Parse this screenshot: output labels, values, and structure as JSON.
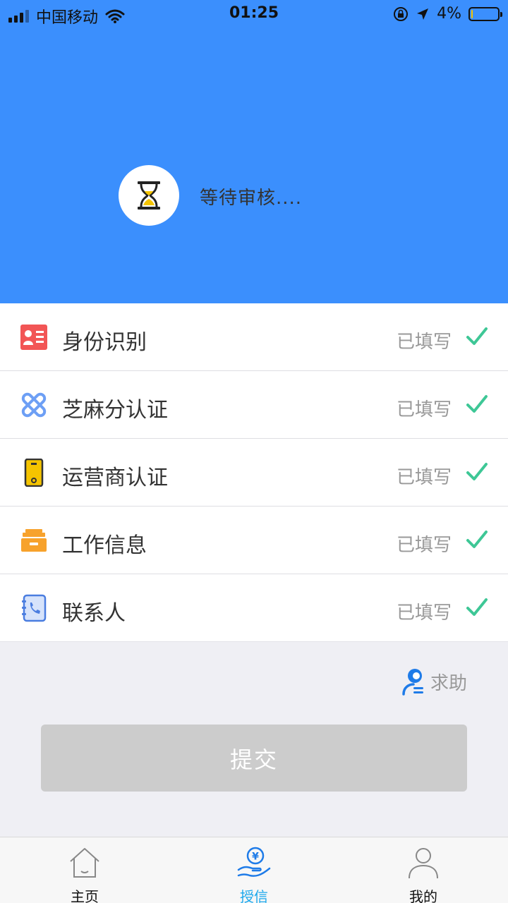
{
  "status_bar": {
    "carrier": "中国移动",
    "time": "01:25",
    "battery": "4%",
    "battery_level": 0.04
  },
  "header": {
    "status_text": "等待审核....",
    "icon": "hourglass-icon",
    "background": "#3b8ffd"
  },
  "items": [
    {
      "label": "身份识别",
      "status": "已填写",
      "icon": "id-card-icon"
    },
    {
      "label": "芝麻分认证",
      "status": "已填写",
      "icon": "sesame-icon"
    },
    {
      "label": "运营商认证",
      "status": "已填写",
      "icon": "phone-icon"
    },
    {
      "label": "工作信息",
      "status": "已填写",
      "icon": "briefcase-icon"
    },
    {
      "label": "联系人",
      "status": "已填写",
      "icon": "contacts-icon"
    }
  ],
  "help": {
    "label": "求助",
    "icon": "help-icon"
  },
  "submit": {
    "label": "提交"
  },
  "tabbar": {
    "items": [
      {
        "label": "主页",
        "icon": "home-icon",
        "active": false
      },
      {
        "label": "授信",
        "icon": "credit-icon",
        "active": true
      },
      {
        "label": "我的",
        "icon": "user-icon",
        "active": false
      }
    ]
  },
  "colors": {
    "accent": "#3b8ffd",
    "check": "#3ec796",
    "active_tab": "#1aa7ec"
  }
}
